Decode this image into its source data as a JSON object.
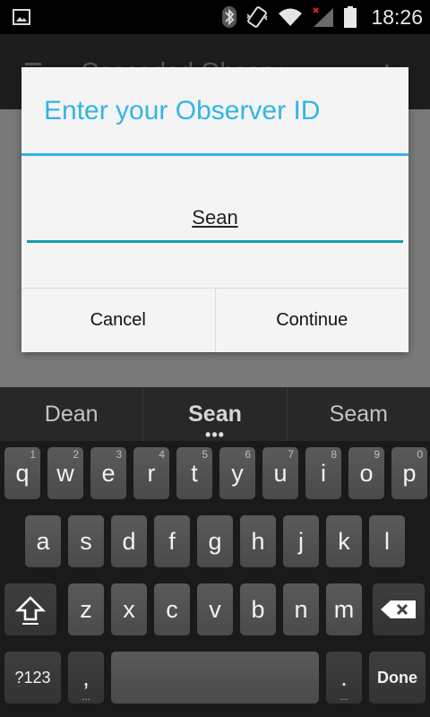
{
  "status_bar": {
    "time": "18:26",
    "icons": [
      "image-notification-icon",
      "bluetooth-icon",
      "phone-vibrate-icon",
      "wifi-icon",
      "signal-icon",
      "battery-icon"
    ]
  },
  "app": {
    "title": "Cascaded Observ...",
    "menu_icon": "menu-icon",
    "overflow_icon": "more-icon"
  },
  "dialog": {
    "title": "Enter your Observer ID",
    "input_value": "Sean",
    "cancel_label": "Cancel",
    "continue_label": "Continue",
    "accent_color": "#33b5e5",
    "input_line_color": "#149da4"
  },
  "keyboard": {
    "suggestions": [
      "Dean",
      "Sean",
      "Seam"
    ],
    "suggestion_dots": "•••",
    "row1": [
      {
        "k": "q",
        "h": "1"
      },
      {
        "k": "w",
        "h": "2"
      },
      {
        "k": "e",
        "h": "3"
      },
      {
        "k": "r",
        "h": "4"
      },
      {
        "k": "t",
        "h": "5"
      },
      {
        "k": "y",
        "h": "6"
      },
      {
        "k": "u",
        "h": "7"
      },
      {
        "k": "i",
        "h": "8"
      },
      {
        "k": "o",
        "h": "9"
      },
      {
        "k": "p",
        "h": "0"
      }
    ],
    "row2": [
      "a",
      "s",
      "d",
      "f",
      "g",
      "h",
      "j",
      "k",
      "l"
    ],
    "row3": [
      "z",
      "x",
      "c",
      "v",
      "b",
      "n",
      "m"
    ],
    "symbols_label": "?123",
    "comma_label": ",",
    "period_label": ".",
    "done_label": "Done",
    "ellipsis": "..."
  }
}
